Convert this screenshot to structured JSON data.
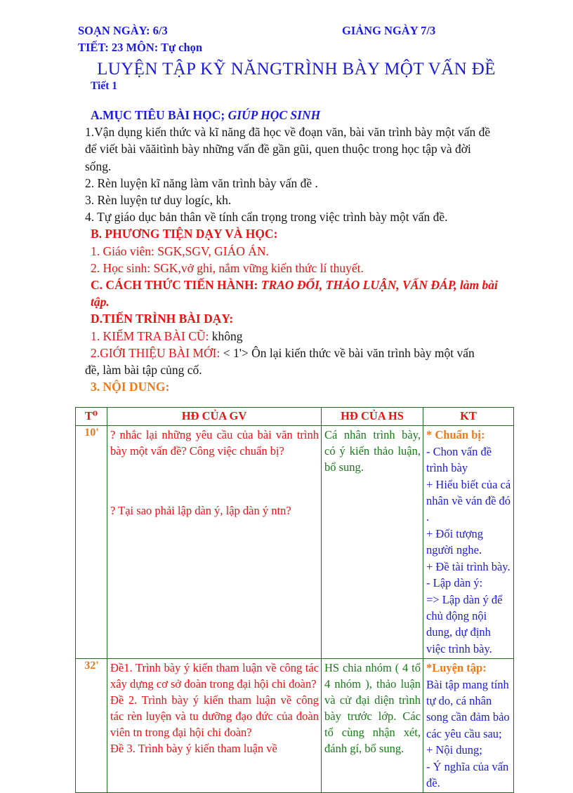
{
  "header": {
    "soan_ngay": "SOẠN NGÀY: 6/3",
    "giang_ngay": "GIẢNG NGÀY 7/3",
    "tiet_mon": "TIẾT: 23 MÔN: Tự chọn",
    "main_title": "LUYỆN TẬP KỸ NĂNGTRÌNH BÀY MỘT VẤN ĐỀ",
    "sub_title": "Tiết 1"
  },
  "sections": {
    "a_heading_part1": "A.MỤC TIÊU BÀI HỌC;",
    "a_heading_part2": "GIÚP HỌC SINH",
    "a_items": [
      "1.Vận dụng kiến thức và kĩ năng đã học về đoạn văn, bài văn trình bày một vấn đề",
      "để viết bài văăitình bày những vấn đề  gần gũi, quen thuộc trong học tập và đời",
      "sống.",
      "2. Rèn luyện kĩ năng làm văn trình bày vấn đề .",
      "3. Rèn luyện tư duy logíc, kh.",
      "4. Tự giáo dục bản thân về tính cẩn trọng trong việc trình bày một vấn đề."
    ],
    "b_heading": "B. PHƯƠNG TIỆN DẠY VÀ HỌC:",
    "b_items": [
      "1. Giáo viên:  SGK,SGV, GIÁO ÁN.",
      "2. Học sinh: SGK,vở ghi, nắm vững kiến thức lí thuyết."
    ],
    "c_heading": "C. CÁCH THỨC TIẾN HÀNH:",
    "c_value_line1": "TRAO ĐỔI, THẢO LUẬN, VẤN ĐÁP, làm bài",
    "c_value_line2": "tập.",
    "d_heading": "D.TIẾN TRÌNH BÀI DẠY:",
    "d1_label": "1. KIỂM TRA BÀI CŨ:",
    "d1_value": "không",
    "d2_label": "2.GIỚI THIỆU BÀI MỚI:",
    "d2_value_line1": "< 1'>  Ôn lại kiến thức về bài văn trình bày một vấn",
    "d2_value_line2": "đề, làm bài tập củng cố.",
    "d3_heading": "3. NỘI DUNG:"
  },
  "table": {
    "columns": [
      "T⁰",
      "HĐ CỦA GV",
      "HĐ CỦA HS",
      "KT"
    ],
    "rows": [
      {
        "time": "10'",
        "gv_block1": "? nhắc lại những yêu cầu của bài văn trình bày một vấn đề? Công việc chuẩn bị?",
        "gv_block2": "? Tại sao phải lập dàn ý, lập dàn ý ntn?",
        "hs": "Cá nhân trình bày, có ý kiến thảo luận, bổ sung.",
        "kt_head": "* Chuẩn bị:",
        "kt_lines": [
          "- Chon vấn đề trình bày",
          "+ Hiểu biết của cá nhân về ván đề đó .",
          "+ Đối tượng người nghe.",
          "+ Đề tài trình bày.",
          "- Lập dàn ý:",
          "=> Lập dàn ý để chủ động nội dung, dự định việc trình bày."
        ]
      },
      {
        "time": "32'",
        "gv_block1": "Đề1. Trình bày ý kiến tham luận về công tác xây dựng cơ sở đoàn trong đại hội chi đoàn?",
        "gv_block2": "Đề 2. Trình bày ý kiến tham luận về công tác rèn luyện và tu dưỡng đạo đức của đoàn viên tn trong đại hội chi đoàn?",
        "gv_block3": "Đề 3. Trình bày ý kiến tham luận về",
        "hs": "HS chia nhóm ( 4 tổ 4 nhóm ), thảo luận và cử đại diện trình bày trước lớp. Các tổ cùng nhận xét, đánh gí, bổ sung.",
        "kt_head": "*Luyện tập:",
        "kt_lines": [
          "Bài tập mang tính tự do, cá nhân song cần đảm bảo các yêu cầu sau;",
          "+ Nội dung;",
          "- Ý nghĩa của vấn đề."
        ]
      }
    ]
  },
  "colors": {
    "blue": "#1a1ae0",
    "red": "#ee1111",
    "orange": "#f07818",
    "green": "#1a7a1a",
    "black": "#161616",
    "table_border": "#1f6b1f"
  }
}
